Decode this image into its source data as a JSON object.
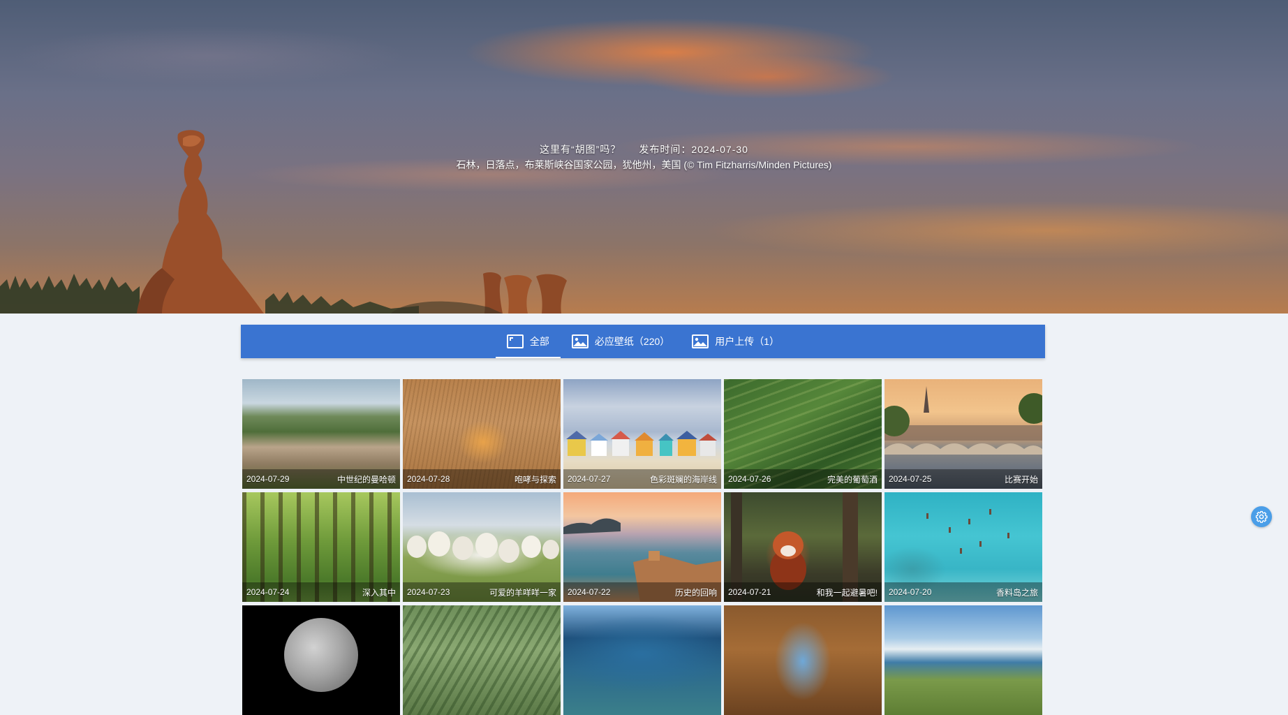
{
  "hero": {
    "title": "这里有“胡图”吗？",
    "publish_label": "发布时间：2024-07-30",
    "description": "石林，日落点，布莱斯峡谷国家公园，犹他州，美国 (© Tim Fitzharris/Minden Pictures)"
  },
  "tabs": [
    {
      "label": "全部",
      "icon": "fullscreen-icon",
      "active": true
    },
    {
      "label": "必应壁纸（220）",
      "icon": "image-icon",
      "active": false
    },
    {
      "label": "用户上传（1）",
      "icon": "image-icon",
      "active": false
    }
  ],
  "cards": [
    {
      "date": "2024-07-29",
      "title": "中世纪的曼哈顿"
    },
    {
      "date": "2024-07-28",
      "title": "咆哮与探索"
    },
    {
      "date": "2024-07-27",
      "title": "色彩斑斓的海岸线"
    },
    {
      "date": "2024-07-26",
      "title": "完美的葡萄酒"
    },
    {
      "date": "2024-07-25",
      "title": "比赛开始"
    },
    {
      "date": "2024-07-24",
      "title": "深入其中"
    },
    {
      "date": "2024-07-23",
      "title": "可爱的羊咩咩一家"
    },
    {
      "date": "2024-07-22",
      "title": "历史的回响"
    },
    {
      "date": "2024-07-21",
      "title": "和我一起避暑吧!"
    },
    {
      "date": "2024-07-20",
      "title": "香料岛之旅"
    },
    {
      "date": "",
      "title": ""
    },
    {
      "date": "",
      "title": ""
    },
    {
      "date": "",
      "title": ""
    },
    {
      "date": "",
      "title": ""
    },
    {
      "date": "",
      "title": ""
    }
  ],
  "colors": {
    "tab_bar": "#3a74d1",
    "page_bg": "#eef2f7",
    "settings_button": "#4a9ee8"
  },
  "settings_icon": "gear-icon"
}
